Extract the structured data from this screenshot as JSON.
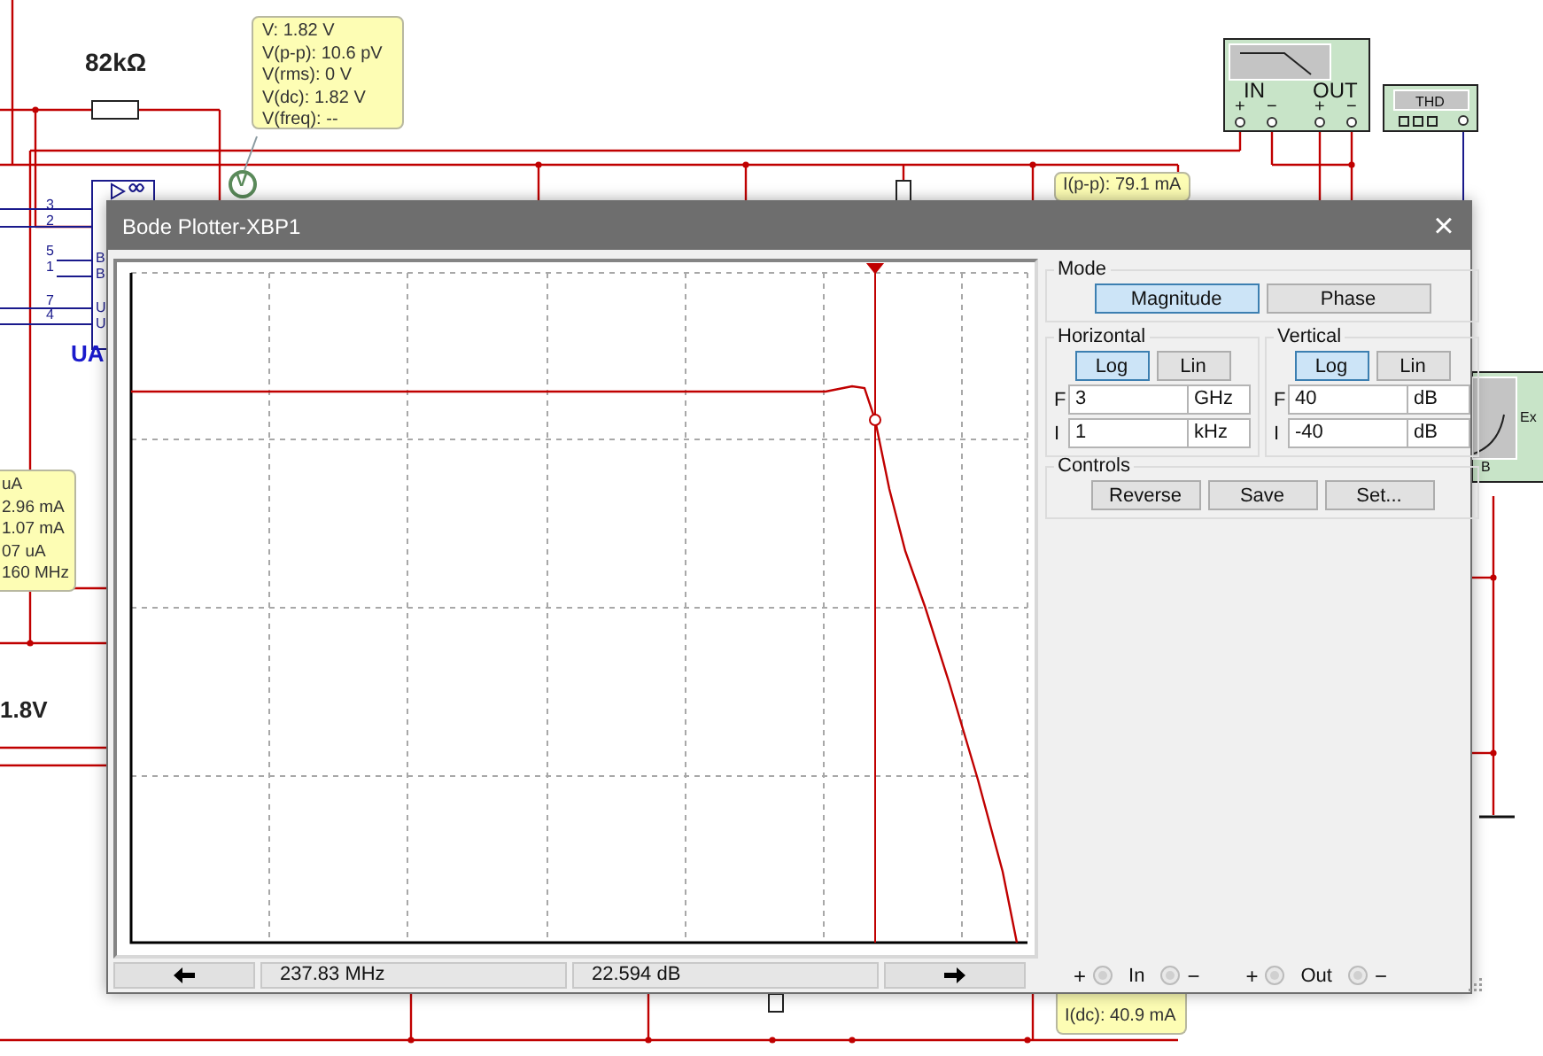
{
  "schematic": {
    "resistor_label": "82kΩ",
    "source_label": "1.8V",
    "opamp": {
      "label": "UA",
      "pins": [
        "3",
        "2",
        "5",
        "1",
        "7",
        "4"
      ],
      "pin_letters": [
        "B",
        "B",
        "U",
        "U"
      ]
    },
    "voltage_probe": {
      "symbol": "V",
      "readings": [
        "V: 1.82 V",
        "V(p-p): 10.6 pV",
        "V(rms): 0 V",
        "V(dc): 1.82 V",
        "V(freq): --"
      ]
    },
    "current_probes": [
      {
        "readings": [
          "I(p-p): 79.1 mA"
        ]
      },
      {
        "readings": [
          "uA",
          "2.96 mA",
          "1.07 mA",
          "07 uA",
          "160 MHz"
        ]
      },
      {
        "readings": [
          "I(dc): 40.9 mA"
        ]
      }
    ],
    "bode_instrument": {
      "in_label": "IN",
      "out_label": "OUT",
      "terminals": [
        "+",
        "−",
        "+",
        "−"
      ]
    },
    "thd_meter": {
      "label": "THD"
    },
    "analyzer": {
      "label": "Ex",
      "pin": "B"
    }
  },
  "dialog": {
    "title": "Bode Plotter-XBP1",
    "close": "×",
    "mode": {
      "legend": "Mode",
      "options": [
        {
          "label": "Magnitude",
          "selected": true
        },
        {
          "label": "Phase",
          "selected": false
        }
      ]
    },
    "axes": [
      {
        "legend": "Horizontal",
        "scales": [
          {
            "label": "Log",
            "selected": true
          },
          {
            "label": "Lin",
            "selected": false
          }
        ],
        "limits": [
          {
            "tag": "F",
            "value": "3",
            "unit": "GHz"
          },
          {
            "tag": "I",
            "value": "1",
            "unit": "kHz"
          }
        ]
      },
      {
        "legend": "Vertical",
        "scales": [
          {
            "label": "Log",
            "selected": true
          },
          {
            "label": "Lin",
            "selected": false
          }
        ],
        "limits": [
          {
            "tag": "F",
            "value": "40",
            "unit": "dB"
          },
          {
            "tag": "I",
            "value": "-40",
            "unit": "dB"
          }
        ]
      }
    ],
    "controls": {
      "legend": "Controls",
      "buttons": [
        "Reverse",
        "Save",
        "Set..."
      ]
    },
    "readout": {
      "frequency": "237.83 MHz",
      "gain": "22.594 dB"
    },
    "terminals": [
      {
        "plus": "+",
        "name": "In",
        "minus": "−"
      },
      {
        "plus": "+",
        "name": "Out",
        "minus": "−"
      }
    ]
  }
}
